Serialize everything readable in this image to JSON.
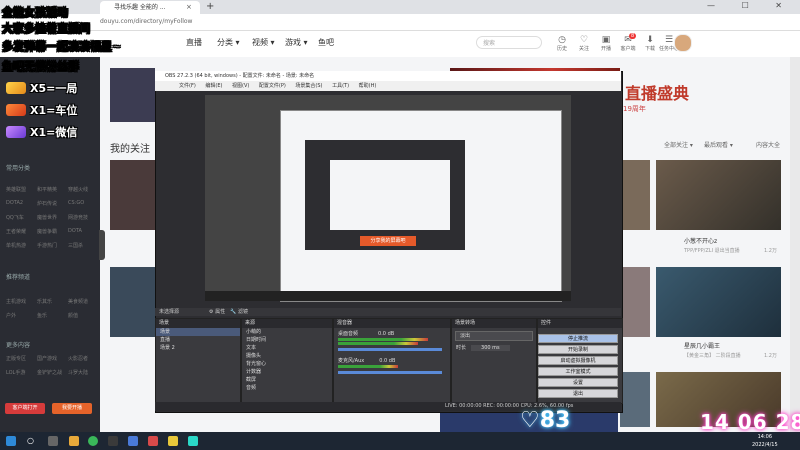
{
  "browser": {
    "tab_title": "寻找乐趣 全能的 ...",
    "tab_close": "×",
    "new_tab": "+",
    "window_controls": "— ☐ ✕",
    "url": "douyu.com/directory/myFollow"
  },
  "site": {
    "nav": [
      "直播",
      "分类 ▾",
      "视频 ▾",
      "游戏 ▾",
      "鱼吧"
    ],
    "search_placeholder": "搜索",
    "header_icons": [
      {
        "icon": "history-icon",
        "label": "历史"
      },
      {
        "icon": "follow-icon",
        "label": "关注"
      },
      {
        "icon": "broadcast-icon",
        "label": "开播"
      },
      {
        "icon": "message-icon",
        "label": "客户端"
      },
      {
        "icon": "download-icon",
        "label": "下载"
      },
      {
        "icon": "task-icon",
        "label": "任务中心"
      }
    ],
    "badge_count": "8",
    "sidebar": {
      "common_head": "常用分类",
      "common_items": [
        "英雄联盟",
        "和平精英",
        "穿越火线",
        "DOTA2",
        "炉石传说",
        "CS:GO",
        "QQ飞车",
        "魔兽世界",
        "网游竞技",
        "王者荣耀",
        "魔兽争霸",
        "DOTA",
        "单机热游",
        "手游热门",
        "三国杀"
      ],
      "recommend_head": "推荐频道",
      "recommend_items": [
        "主机游戏",
        "乐其乐",
        "美食频道",
        "户外",
        "鱼乐",
        "颜值"
      ],
      "more_head": "更多内容",
      "more_items": [
        "正版专区",
        "国产游戏",
        "火影忍者",
        "LOL手游",
        "金铲铲之战",
        "斗罗大陆"
      ],
      "button_open": "客户端打开",
      "button_live": "我要开播"
    },
    "banner_title": "直播盛典",
    "banner_sub": "19周年",
    "section_title": "我的关注",
    "filters": [
      "全部关注 ▾",
      "最后观看 ▾",
      "筛选条件 ▾",
      "内容大全"
    ],
    "cards": [
      {
        "title": "小葱不开心z",
        "sub": "TPP/FPP/ZLI 退出当直播"
      },
      {
        "title": "星辰几小霸王",
        "sub": "【黄金三角】 二阶段直播"
      }
    ],
    "card_stat": "1.2万"
  },
  "overlay": {
    "lines": [
      "全能女孩活动",
      "大家多挂着直播间",
      "多发弹幕一起凑凑福星~",
      "鱼吧无偿粉丝群"
    ],
    "rewards": [
      "X5=一局",
      "X1=车位",
      "X1=微信"
    ],
    "like_count": "83",
    "clock": "14 06 28"
  },
  "obs": {
    "title": "OBS 27.2.3 (64 bit, windows) - 配置文件: 未命名 - 场景: 未命名",
    "menu": [
      "文件(F)",
      "编辑(E)",
      "视图(V)",
      "配置文件(P)",
      "场景集合(S)",
      "工具(T)",
      "帮助(H)"
    ],
    "preview_caption": "分享我的屏幕吧",
    "docks": {
      "scenes": {
        "title": "场景",
        "items": [
          "场景",
          "直播",
          "场景 2"
        ]
      },
      "sources": {
        "title": "来源",
        "items": [
          "小萌的",
          "日期时间",
          "文本",
          "摄像头",
          "背光窗心",
          "计数器",
          "截屏",
          "音频"
        ]
      },
      "mixer": {
        "title": "混音器",
        "tracks": [
          {
            "name": "桌面音频",
            "db": "0.0 dB"
          },
          {
            "name": "麦克风/Aux",
            "db": "0.0 dB"
          }
        ]
      },
      "transitions": {
        "title": "场景转场",
        "type": "淡出",
        "duration_label": "时长",
        "duration": "300 ms"
      },
      "controls": {
        "title": "控件",
        "buttons": [
          "停止推流",
          "开始录制",
          "启动虚拟摄像机",
          "工作室模式",
          "设置",
          "退出"
        ]
      }
    },
    "status": "LIVE: 00:00:00  REC: 00:00:00  CPU: 2.6%, 60.00 fps",
    "scene_filter_label": "未选择源",
    "properties_label": "⚙ 属性",
    "filters_label": "🔧 滤镜"
  },
  "taskbar": {
    "time": "14:06",
    "date": "2022/4/15"
  }
}
